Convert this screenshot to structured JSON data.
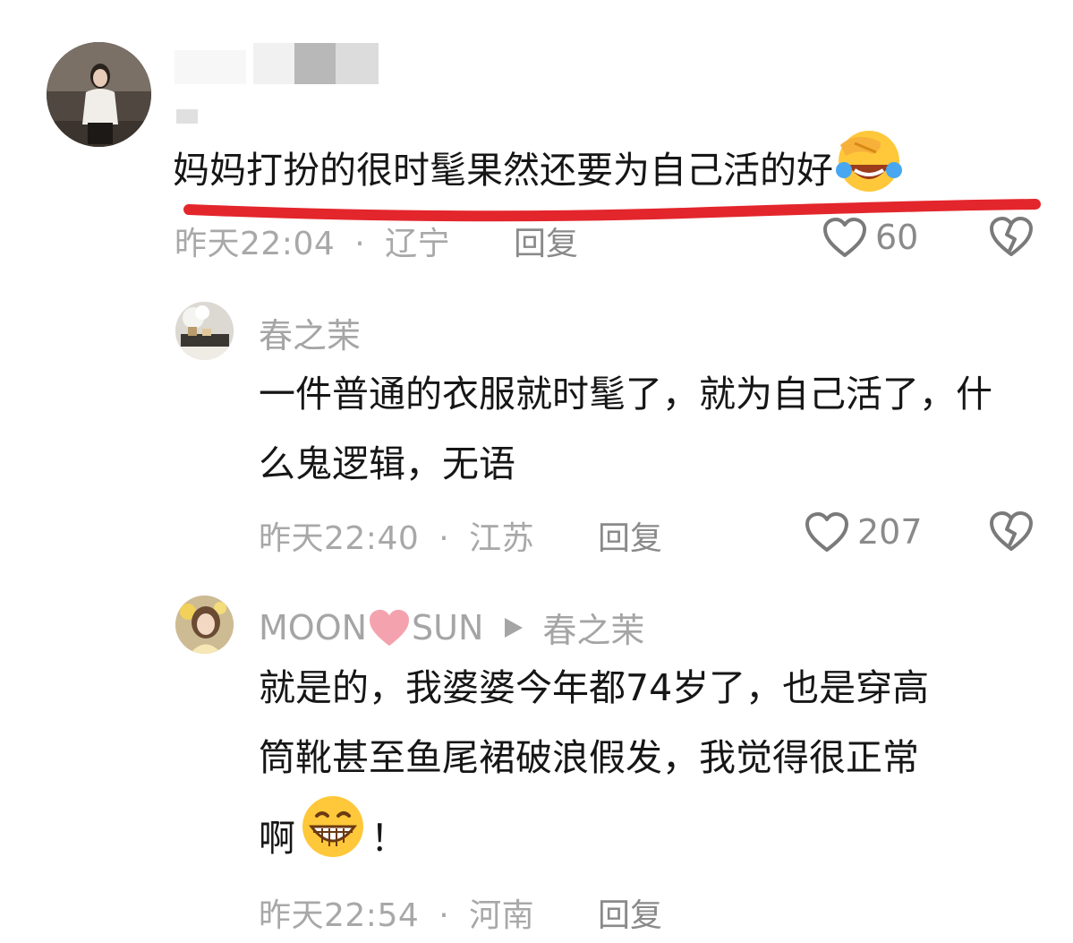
{
  "comments": [
    {
      "text": "妈妈打扮的很时髦果然还要为自己活的好",
      "emoji": "face-with-tears-of-joy",
      "time": "昨天22:04",
      "location": "辽宁",
      "reply_label": "回复",
      "likes": "60"
    },
    {
      "username": "春之茉",
      "text": "一件普通的衣服就时髦了，就为自己活了，什么鬼逻辑，无语",
      "time": "昨天22:40",
      "location": "江苏",
      "reply_label": "回复",
      "likes": "207"
    },
    {
      "username_prefix": "MOON",
      "username_suffix": "SUN",
      "reply_to": "春之茉",
      "text_line1": "就是的，我婆婆今年都74岁了，也是穿高",
      "text_line2": "筒靴甚至鱼尾裙破浪假发，我觉得很正常",
      "text_line3_a": "啊",
      "text_line3_b": "！",
      "emoji": "grinning-face",
      "time": "昨天22:54",
      "location": "河南",
      "reply_label": "回复"
    }
  ],
  "separator": "·",
  "colors": {
    "underline": "#e3262c",
    "meta": "#a8a8a8",
    "heart_pink": "#f4a3ae",
    "emoji_yellow": "#ffc83a"
  }
}
